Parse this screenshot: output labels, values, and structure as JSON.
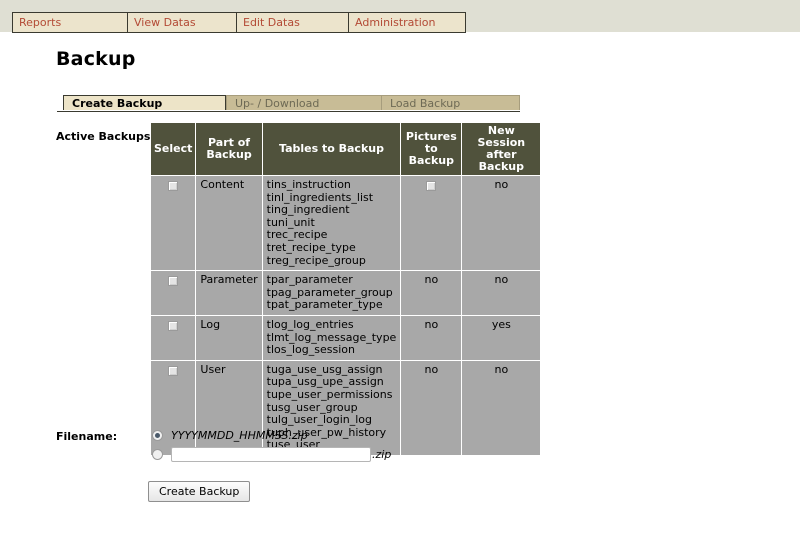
{
  "menu": {
    "items": [
      {
        "label": "Reports"
      },
      {
        "label": "View Datas"
      },
      {
        "label": "Edit Datas"
      },
      {
        "label": "Administration"
      }
    ]
  },
  "page": {
    "title": "Backup"
  },
  "tabs": [
    {
      "label": "Create Backup",
      "active": true
    },
    {
      "label": "Up- / Download",
      "active": false
    },
    {
      "label": "Load Backup",
      "active": false
    }
  ],
  "backups": {
    "label": "Active Backups:",
    "columns": [
      "Select",
      "Part of Backup",
      "Tables to Backup",
      "Pictures to Backup",
      "New Session after Backup"
    ],
    "column_lines": {
      "select": [
        "Select"
      ],
      "part": [
        "Part of",
        "Backup"
      ],
      "tables": [
        "Tables to Backup"
      ],
      "pictures": [
        "Pictures",
        "to Backup"
      ],
      "session": [
        "New Session",
        "after Backup"
      ]
    },
    "rows": [
      {
        "select_checked": false,
        "part": "Content",
        "tables": [
          "tins_instruction",
          "tinl_ingredients_list",
          "ting_ingredient",
          "tuni_unit",
          "trec_recipe",
          "tret_recipe_type",
          "treg_recipe_group"
        ],
        "pictures_type": "checkbox",
        "pictures": "",
        "pictures_checked": false,
        "new_session": "no"
      },
      {
        "select_checked": false,
        "part": "Parameter",
        "tables": [
          "tpar_parameter",
          "tpag_parameter_group",
          "tpat_parameter_type"
        ],
        "pictures_type": "text",
        "pictures": "no",
        "new_session": "no"
      },
      {
        "select_checked": false,
        "part": "Log",
        "tables": [
          "tlog_log_entries",
          "tlmt_log_message_type",
          "tlos_log_session"
        ],
        "pictures_type": "text",
        "pictures": "no",
        "new_session": "yes"
      },
      {
        "select_checked": false,
        "part": "User",
        "tables": [
          "tuga_use_usg_assign",
          "tupa_usg_upe_assign",
          "tupe_user_permissions",
          "tusg_user_group",
          "tulg_user_login_log",
          "tuph_user_pw_history",
          "tuse_user"
        ],
        "pictures_type": "text",
        "pictures": "no",
        "new_session": "no"
      }
    ]
  },
  "filename": {
    "label": "Filename:",
    "auto_option": "YYYYMMDD_HHMMSS.zip",
    "auto_selected": true,
    "custom_selected": false,
    "custom_value": "",
    "custom_placeholder": "",
    "custom_suffix": ".zip"
  },
  "actions": {
    "create_backup": "Create Backup"
  },
  "colors": {
    "topbar": "#dfdfd3",
    "menu_bg": "#ece4cc",
    "menu_text": "#b34a35",
    "tab_active_bg": "#ede4c8",
    "tab_inactive_bg": "#c8bc96",
    "table_header_bg": "#50523c",
    "table_cell_bg": "#a8a8a8"
  }
}
